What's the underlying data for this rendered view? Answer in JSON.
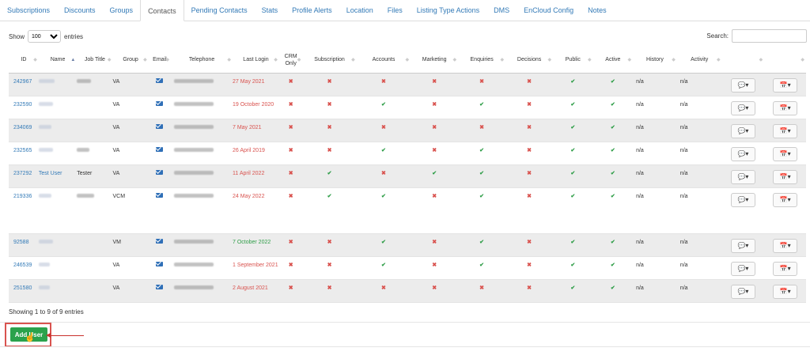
{
  "tabs": [
    "Subscriptions",
    "Discounts",
    "Groups",
    "Contacts",
    "Pending Contacts",
    "Stats",
    "Profile Alerts",
    "Location",
    "Files",
    "Listing Type Actions",
    "DMS",
    "EnCloud Config",
    "Notes"
  ],
  "active_tab": "Contacts",
  "length_control": {
    "show_label": "Show",
    "selected": "100",
    "entries_label": "entries"
  },
  "search": {
    "label": "Search:",
    "value": ""
  },
  "columns": [
    "ID",
    "Name",
    "Job Title",
    "Group",
    "Email",
    "Telephone",
    "Last Login",
    "CRM Only",
    "Subscription",
    "Accounts",
    "Marketing",
    "Enquiries",
    "Decisions",
    "Public",
    "Active",
    "History",
    "Activity"
  ],
  "rows": [
    {
      "id": "242967",
      "name": "",
      "job": "",
      "group": "VA",
      "last_login": "27 May 2021",
      "login_status": "red",
      "flags": [
        "x",
        "x",
        "x",
        "x",
        "x",
        "x",
        "ok",
        "ok"
      ],
      "history": "n/a",
      "activity": "n/a"
    },
    {
      "id": "232590",
      "name": "",
      "job": "",
      "group": "VA",
      "last_login": "19 October 2020",
      "login_status": "red",
      "flags": [
        "x",
        "x",
        "ok",
        "x",
        "ok",
        "x",
        "ok",
        "ok"
      ],
      "history": "n/a",
      "activity": "n/a"
    },
    {
      "id": "234069",
      "name": "",
      "job": "",
      "group": "VA",
      "last_login": "7 May 2021",
      "login_status": "red",
      "flags": [
        "x",
        "x",
        "x",
        "x",
        "x",
        "x",
        "ok",
        "ok"
      ],
      "history": "n/a",
      "activity": "n/a"
    },
    {
      "id": "232565",
      "name": "",
      "job": "",
      "group": "VA",
      "last_login": "26 April 2019",
      "login_status": "red",
      "flags": [
        "x",
        "x",
        "ok",
        "x",
        "ok",
        "x",
        "ok",
        "ok"
      ],
      "history": "n/a",
      "activity": "n/a"
    },
    {
      "id": "237292",
      "name": "Test User",
      "job": "Tester",
      "group": "VA",
      "last_login": "11 April 2022",
      "login_status": "red",
      "flags": [
        "x",
        "ok",
        "x",
        "ok",
        "ok",
        "x",
        "ok",
        "ok"
      ],
      "history": "n/a",
      "activity": "n/a"
    },
    {
      "id": "219336",
      "name": "",
      "job": "",
      "group": "VCM",
      "last_login": "24 May 2022",
      "login_status": "red",
      "flags": [
        "x",
        "ok",
        "ok",
        "x",
        "ok",
        "x",
        "ok",
        "ok"
      ],
      "history": "n/a",
      "activity": "n/a"
    },
    {
      "id": "92588",
      "name": "",
      "job": "",
      "group": "VM",
      "last_login": "7 October 2022",
      "login_status": "green",
      "flags": [
        "x",
        "x",
        "ok",
        "x",
        "ok",
        "x",
        "ok",
        "ok"
      ],
      "history": "n/a",
      "activity": "n/a"
    },
    {
      "id": "246539",
      "name": "",
      "job": "",
      "group": "VA",
      "last_login": "1 September 2021",
      "login_status": "red",
      "flags": [
        "x",
        "x",
        "ok",
        "x",
        "ok",
        "x",
        "ok",
        "ok"
      ],
      "history": "n/a",
      "activity": "n/a"
    },
    {
      "id": "251580",
      "name": "",
      "job": "",
      "group": "VA",
      "last_login": "2 August 2021",
      "login_status": "red",
      "flags": [
        "x",
        "x",
        "x",
        "x",
        "x",
        "x",
        "ok",
        "ok"
      ],
      "history": "n/a",
      "activity": "n/a"
    }
  ],
  "info_text": "Showing 1 to 9 of 9 entries",
  "add_button": "Add User",
  "colors": {
    "link": "#337ab7",
    "no": "#d9534f",
    "yes": "#2e9d47",
    "add": "#2ba24c"
  }
}
